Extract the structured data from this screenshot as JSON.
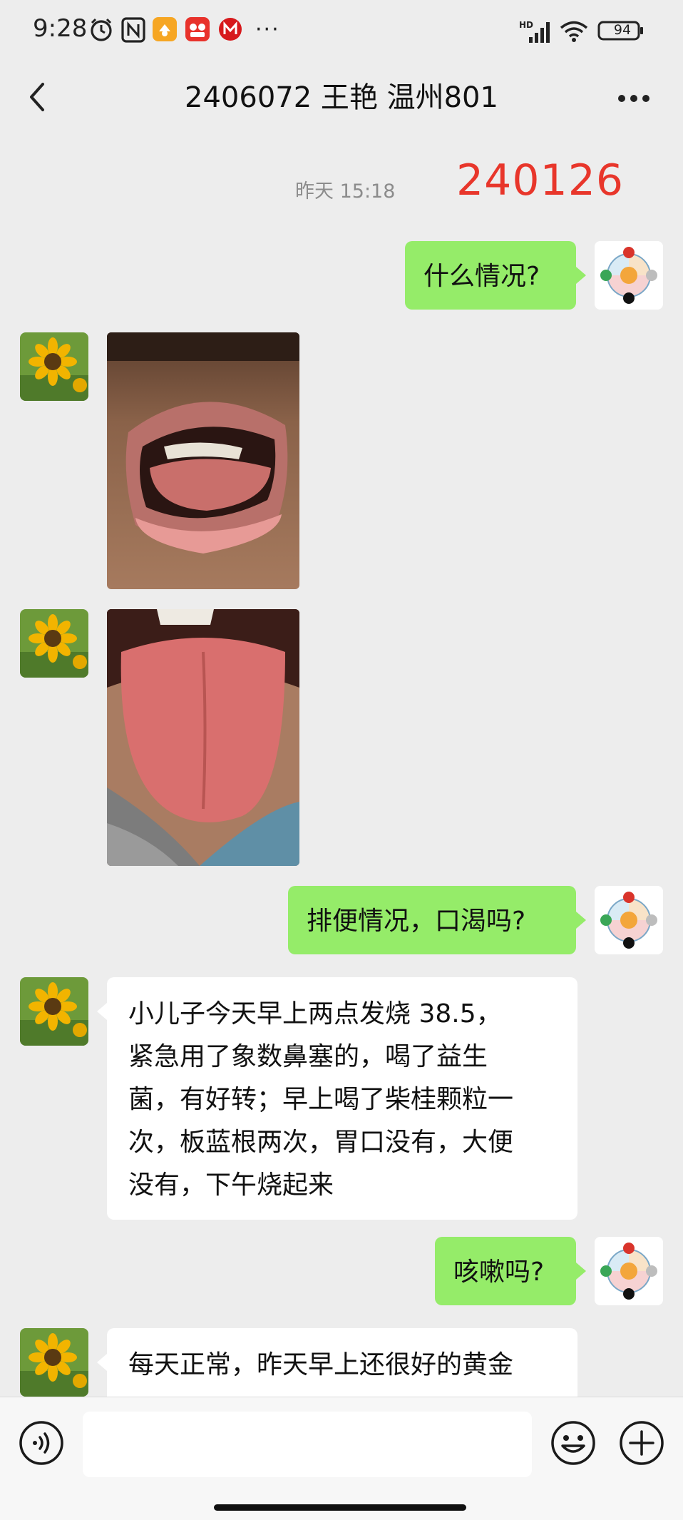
{
  "status_bar": {
    "time": "9:28",
    "battery": "94",
    "network": "HD",
    "more": "···",
    "icons": [
      "alarm-icon",
      "nfc-icon",
      "app-notification-icon",
      "app-notification-icon",
      "app-notification-icon",
      "signal-icon",
      "wifi-icon",
      "battery-icon"
    ]
  },
  "header": {
    "title": "2406072 王艳 温州801",
    "back_icon": "chevron-left-icon",
    "more_icon": "more-icon"
  },
  "chat": {
    "timestamp": "昨天 15:18",
    "annotation": "240126",
    "annotation_color": "#e8362b",
    "messages": {
      "m1": {
        "sender": "me",
        "type": "text",
        "text": "什么情况?"
      },
      "m2": {
        "sender": "contact",
        "type": "image",
        "content": "photo-lips"
      },
      "m3": {
        "sender": "contact",
        "type": "image",
        "content": "photo-tongue"
      },
      "m4": {
        "sender": "me",
        "type": "text",
        "text": "排便情况，口渴吗?"
      },
      "m5": {
        "sender": "contact",
        "type": "text",
        "lines": [
          "小儿子今天早上两点发烧 38.5，",
          "紧急用了象数鼻塞的，喝了益生",
          "菌，有好转；早上喝了柴桂颗粒一",
          "次，板蓝根两次，胃口没有，大便",
          "没有，下午烧起来"
        ]
      },
      "m6": {
        "sender": "me",
        "type": "text",
        "text": "咳嗽吗?"
      },
      "m7": {
        "sender": "contact",
        "type": "text",
        "lines": [
          "每天正常，昨天早上还很好的黄金"
        ]
      }
    }
  },
  "input_bar": {
    "voice_icon": "voice-icon",
    "emoji_icon": "emoji-icon",
    "add_icon": "plus-icon",
    "input_value": ""
  },
  "colors": {
    "background": "#ededed",
    "outgoing_bubble": "#95ec69",
    "incoming_bubble": "#ffffff",
    "timestamp_text": "#8c8c8c"
  }
}
